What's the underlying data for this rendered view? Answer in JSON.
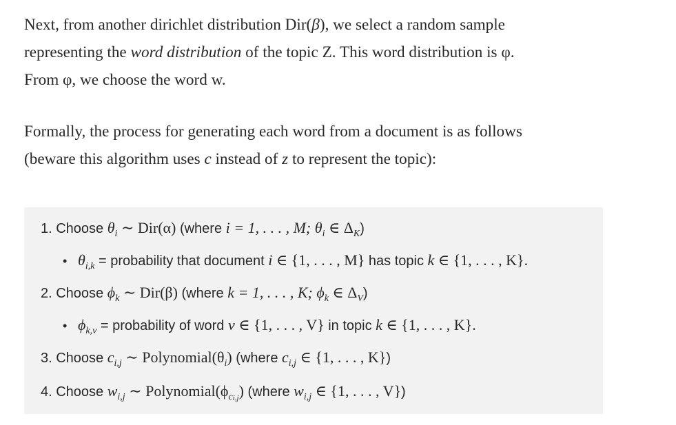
{
  "p1": {
    "a": "Next, from another dirichlet distribution Dir(",
    "beta": "β",
    "b": "), we select a random sample",
    "c": "representing the ",
    "em": "word distribution",
    "d": " of the topic Z. This word distribution is φ.",
    "e": "From φ, we choose the word w."
  },
  "p2": {
    "a": "Formally, the process for generating each word from a document is as follows",
    "b": "(beware this algorithm uses ",
    "c_var": "c",
    "c": " instead of ",
    "z_var": "z",
    "d": " to represent the topic):"
  },
  "list": {
    "l1_pre": "1. Choose ",
    "l1_math": "θ",
    "l1_sub": "i",
    "l1_rest": " ∼ Dir(α)",
    "l1_where": " (where ",
    "l1_math2": "i = 1, . . . , M; θ",
    "l1_sub2": "i",
    "l1_math3": " ∈ Δ",
    "l1_sub3": "K",
    "l1_close": ")",
    "b1_math": "θ",
    "b1_sub": "i,k",
    "b1_text": " = probability that document ",
    "b1_math2": "i",
    "b1_math3": " ∈ {1, . . . , M}",
    "b1_text2": " has topic ",
    "b1_math4": "k",
    "b1_math5": " ∈ {1, . . . , K}.",
    "l2_pre": "2. Choose ",
    "l2_math": "ϕ",
    "l2_sub": "k",
    "l2_rest": " ∼ Dir(β)",
    "l2_where": " (where ",
    "l2_math2": "k = 1, . . . , K; ϕ",
    "l2_sub2": "k",
    "l2_math3": " ∈ Δ",
    "l2_sub3": "V",
    "l2_close": ")",
    "b2_math": "ϕ",
    "b2_sub": "k,v",
    "b2_text": " = probability of word ",
    "b2_math2": "v",
    "b2_math3": " ∈ {1, . . . , V}",
    "b2_text2": " in topic ",
    "b2_math4": "k",
    "b2_math5": " ∈ {1, . . . , K}.",
    "l3_pre": "3. Choose ",
    "l3_math": "c",
    "l3_sub": "i,j",
    "l3_rest": " ∼ Polynomial(θ",
    "l3_sub2": "i",
    "l3_rest2": ")",
    "l3_where": " (where ",
    "l3_math2": "c",
    "l3_sub3": "i,j",
    "l3_math3": " ∈ {1, . . . , K}",
    "l3_close": ")",
    "l4_pre": "4. Choose ",
    "l4_math": "w",
    "l4_sub": "i,j",
    "l4_rest": " ∼ Polynomial(ϕ",
    "l4_sub2": "c",
    "l4_subsub": "i,j",
    "l4_rest2": ")",
    "l4_where": " (where ",
    "l4_math2": "w",
    "l4_sub3": "i,j",
    "l4_math3": " ∈ {1, . . . , V}",
    "l4_close": ")",
    "bullet": "•"
  }
}
